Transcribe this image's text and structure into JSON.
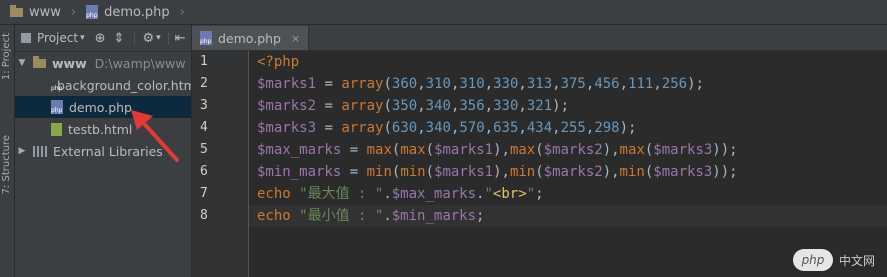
{
  "navbar": {
    "project_name": "www",
    "file_name": "demo.php"
  },
  "project_panel": {
    "dropdown_label": "Project",
    "tree": [
      {
        "name": "www",
        "detail": "D:\\wamp\\www",
        "type": "folder",
        "expanded": true
      },
      {
        "name": "background_color.html",
        "type": "php"
      },
      {
        "name": "demo.php",
        "type": "php",
        "selected": true
      },
      {
        "name": "testb.html",
        "type": "html"
      },
      {
        "name": "External Libraries",
        "type": "library"
      }
    ]
  },
  "side_stripe": {
    "label1": "1: Project",
    "label2": "7: Structure"
  },
  "editor": {
    "tab_label": "demo.php",
    "line_numbers": [
      "1",
      "2",
      "3",
      "4",
      "5",
      "6",
      "7",
      "8"
    ],
    "lines": [
      "<?php",
      "$marks1 = array(360,310,310,330,313,375,456,111,256);",
      "$marks2 = array(350,340,356,330,321);",
      "$marks3 = array(630,340,570,635,434,255,298);",
      "$max_marks = max(max($marks1),max($marks2),max($marks3));",
      "$min_marks = min(min($marks1),min($marks2),min($marks3));",
      "echo \"最大值 : \".$max_marks.\"<br>\";",
      "echo \"最小值 : \".$min_marks;"
    ]
  },
  "watermark": {
    "badge": "php",
    "text": "中文网"
  },
  "colors": {
    "keyword": "#cc7832",
    "variable": "#9876aa",
    "number": "#6897bb",
    "string": "#6a8759",
    "annotation_arrow": "#e53935"
  }
}
